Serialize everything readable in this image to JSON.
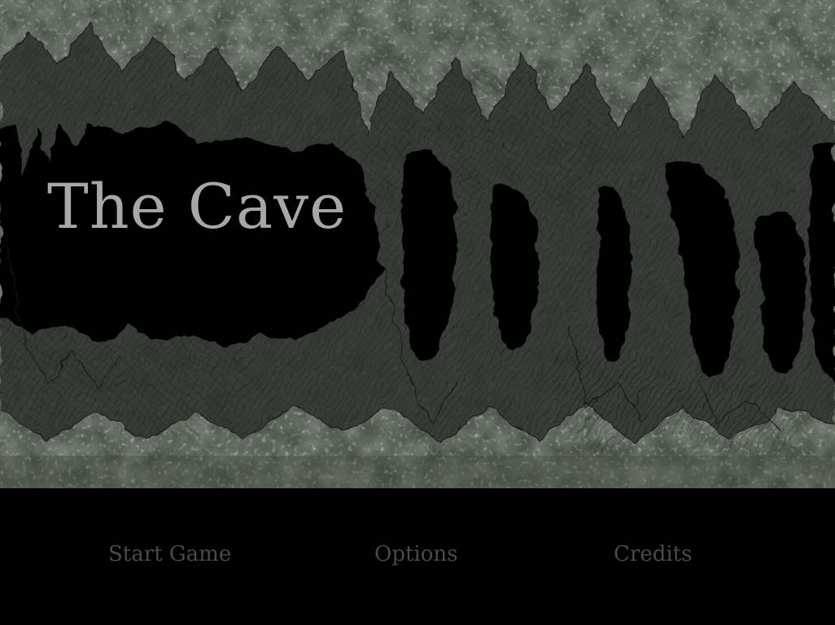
{
  "game": {
    "title": "The Cave"
  },
  "menu": {
    "items": [
      {
        "label": "Start Game"
      },
      {
        "label": "Options"
      },
      {
        "label": "Credits"
      }
    ]
  },
  "colors": {
    "title_text": "#a7a7a7",
    "menu_text": "#4a4a4a",
    "menu_background": "#000000",
    "cave_wall": "#4e554c",
    "cave_shadow": "#0b0b0b"
  }
}
